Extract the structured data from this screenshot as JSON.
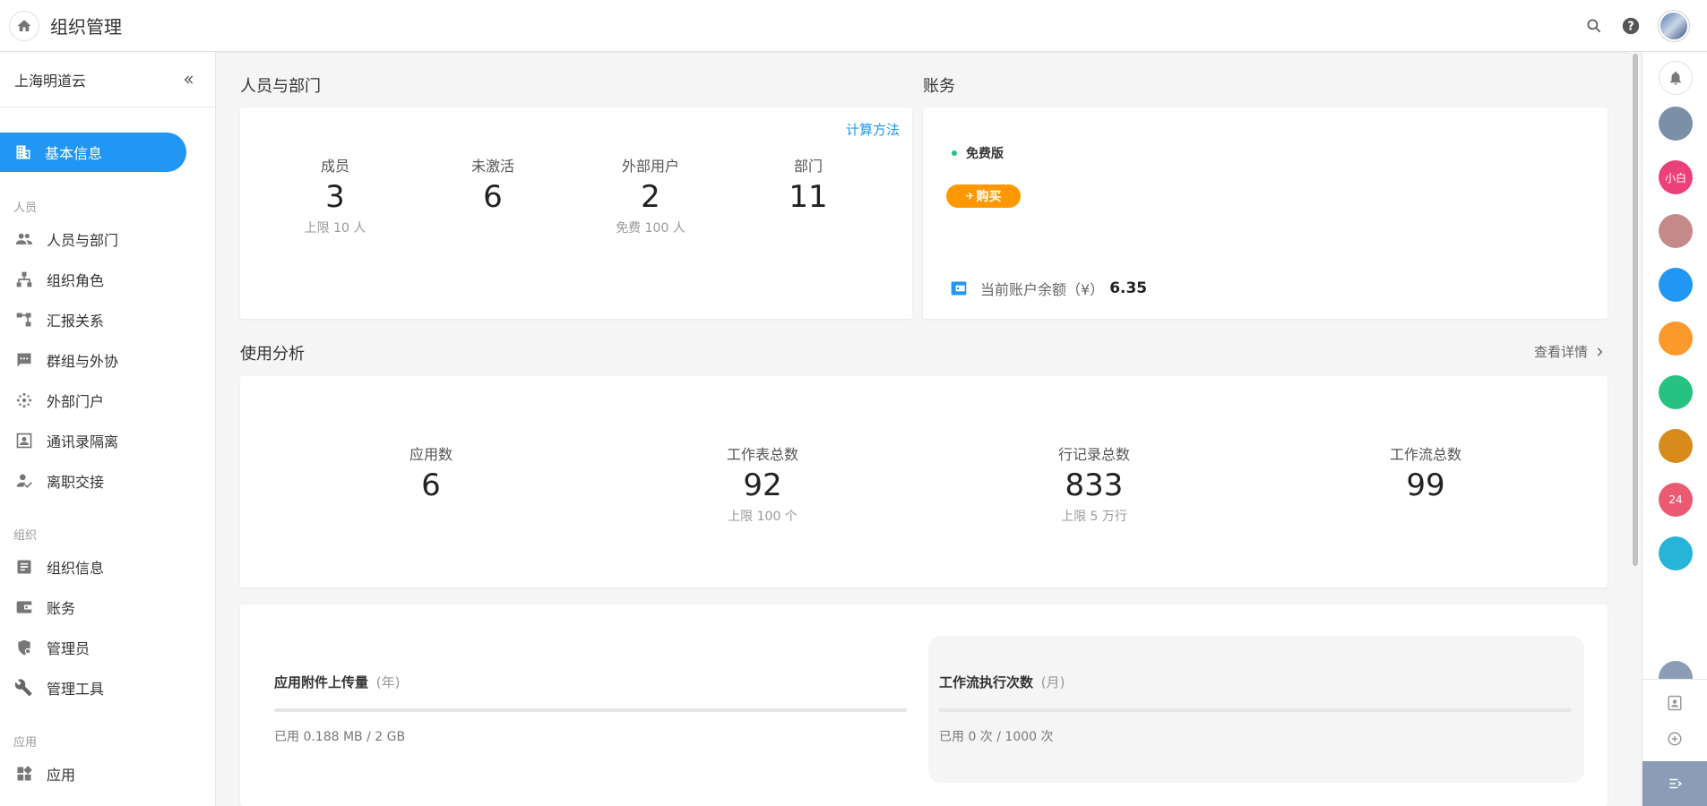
{
  "app": {
    "title": "组织管理"
  },
  "sidebar": {
    "org_name": "上海明道云",
    "active_item": "基本信息",
    "sections": [
      {
        "label": "人员",
        "items": [
          "人员与部门",
          "组织角色",
          "汇报关系",
          "群组与外协",
          "外部门户",
          "通讯录隔离",
          "离职交接"
        ]
      },
      {
        "label": "组织",
        "items": [
          "组织信息",
          "账务",
          "管理员",
          "管理工具"
        ]
      },
      {
        "label": "应用",
        "items": [
          "应用"
        ]
      }
    ]
  },
  "people": {
    "title": "人员与部门",
    "calc_link": "计算方法",
    "stats": [
      {
        "label": "成员",
        "value": "3",
        "sub": "上限 10 人"
      },
      {
        "label": "未激活",
        "value": "6",
        "sub": ""
      },
      {
        "label": "外部用户",
        "value": "2",
        "sub": "免费 100 人"
      },
      {
        "label": "部门",
        "value": "11",
        "sub": ""
      }
    ]
  },
  "billing": {
    "title": "账务",
    "plan": "免费版",
    "buy_label": "购买",
    "balance_label": "当前账户余额（¥）",
    "balance_value": "6.35"
  },
  "usage": {
    "title": "使用分析",
    "details_link": "查看详情",
    "stats": [
      {
        "label": "应用数",
        "value": "6",
        "sub": ""
      },
      {
        "label": "工作表总数",
        "value": "92",
        "sub": "上限 100 个"
      },
      {
        "label": "行记录总数",
        "value": "833",
        "sub": "上限 5 万行"
      },
      {
        "label": "工作流总数",
        "value": "99",
        "sub": ""
      }
    ]
  },
  "quota": {
    "attachments": {
      "title": "应用附件上传量",
      "period": "(年)",
      "used_text": "已用 0.188 MB / 2 GB",
      "fraction": 0.0001
    },
    "workflow": {
      "title": "工作流执行次数",
      "period": "(月)",
      "used_text": "已用 0 次 / 1000 次",
      "fraction": 0
    }
  },
  "rail": {
    "apps": [
      {
        "name": "bell",
        "color": "#7b8fa8",
        "text": ""
      },
      {
        "name": "xiaobai",
        "color": "#ec407a",
        "text": "小白"
      },
      {
        "name": "avatar-photo",
        "color": "#c48a8a",
        "text": ""
      },
      {
        "name": "spark",
        "color": "#2196f3",
        "text": ""
      },
      {
        "name": "grid-app",
        "color": "#fb9a2a",
        "text": ""
      },
      {
        "name": "check-app",
        "color": "#26c281",
        "text": ""
      },
      {
        "name": "flower-photo",
        "color": "#d88a1a",
        "text": ""
      },
      {
        "name": "calendar-app",
        "color": "#ec5a72",
        "text": "24"
      },
      {
        "name": "folder-app",
        "color": "#26b4d8",
        "text": ""
      }
    ]
  }
}
